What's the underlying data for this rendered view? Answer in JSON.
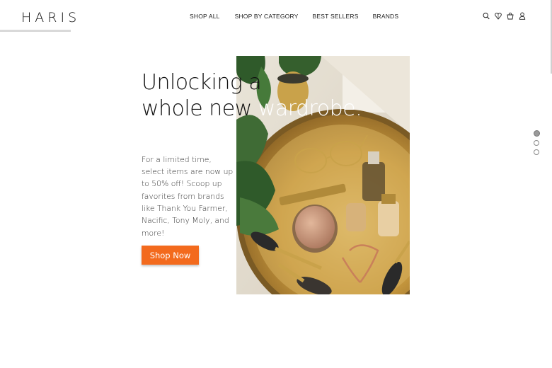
{
  "brand": {
    "logo": "HARIS"
  },
  "nav": {
    "items": [
      {
        "label": "SHOP ALL"
      },
      {
        "label": "SHOP BY CATEGORY"
      },
      {
        "label": "BEST SELLERS"
      },
      {
        "label": "BRANDS"
      }
    ]
  },
  "header_icons": [
    "search-icon",
    "wishlist-icon",
    "cart-icon",
    "account-icon"
  ],
  "hero": {
    "headline_line1": "Unlocking a",
    "headline_line2a": "whole new ",
    "headline_line2b": "wardrobe.",
    "body": "For a limited time, select items are now up to 50% off! Scoop up favorites from brands like Thank You Farmer, Nacific, Tony Moly, and more!",
    "cta_label": "Shop Now",
    "cta_color": "#f36a1d"
  },
  "slider": {
    "slides": 3,
    "active": 1
  }
}
